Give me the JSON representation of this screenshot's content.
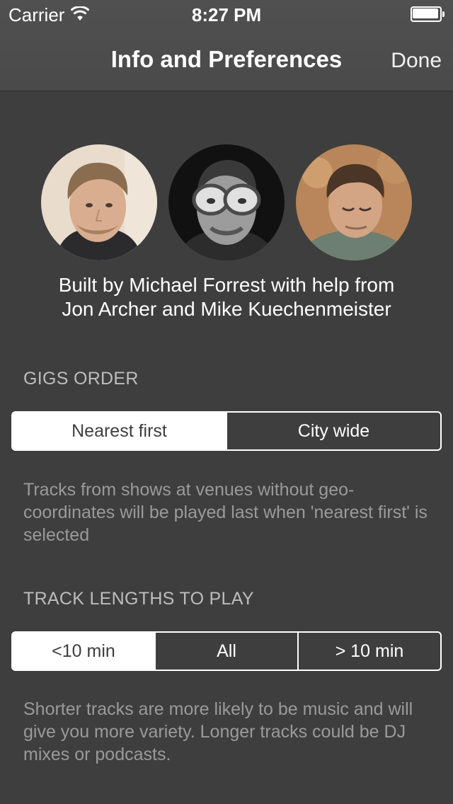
{
  "status_bar": {
    "carrier": "Carrier",
    "time": "8:27 PM",
    "icons": [
      "wifi-icon",
      "battery-icon"
    ]
  },
  "nav": {
    "title": "Info and Preferences",
    "done_label": "Done"
  },
  "credits": {
    "avatars": [
      "avatar-michael-forrest",
      "avatar-jon-archer",
      "avatar-mike-kuechenmeister"
    ],
    "line1": "Built by Michael Forrest with help from",
    "line2": "Jon Archer and Mike Kuechenmeister"
  },
  "gigs_order": {
    "header": "GIGS ORDER",
    "options": [
      "Nearest first",
      "City wide"
    ],
    "selected": "Nearest first",
    "footnote": "Tracks from shows at venues without geo-coordinates will be played last when 'nearest first' is selected"
  },
  "track_lengths": {
    "header": "TRACK LENGTHS TO PLAY",
    "options": [
      "<10 min",
      "All",
      "> 10 min"
    ],
    "selected": "<10 min",
    "footnote": "Shorter tracks are more likely to be music and will give you more variety. Longer tracks could be DJ mixes or podcasts."
  },
  "colors": {
    "background": "#3e3e3e",
    "nav_background": "#4d4d4d",
    "accent": "#ffffff",
    "secondary_text": "#9a9a9a"
  }
}
